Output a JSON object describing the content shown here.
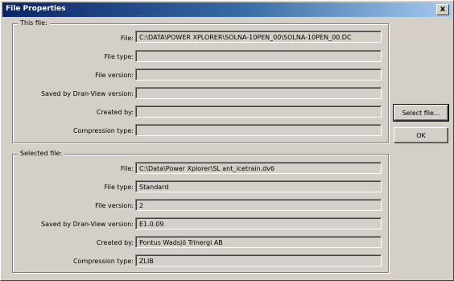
{
  "window": {
    "title": "File Properties",
    "close_label": "x"
  },
  "this_file": {
    "legend": "This file:",
    "rows": [
      {
        "label": "File:",
        "value": "C:\\DATA\\POWER XPLORER\\SOLNA-10PEN_00\\SOLNA-10PEN_00.DC"
      },
      {
        "label": "File type:",
        "value": ""
      },
      {
        "label": "File version:",
        "value": ""
      },
      {
        "label": "Saved by Dran-View version:",
        "value": ""
      },
      {
        "label": "Created by:",
        "value": ""
      },
      {
        "label": "Compression type:",
        "value": ""
      }
    ]
  },
  "selected_file": {
    "legend": "Selected file:",
    "rows": [
      {
        "label": "File:",
        "value": "C:\\Data\\Power Xplorer\\SL ant_icetrain.dv6"
      },
      {
        "label": "File type:",
        "value": "Standard"
      },
      {
        "label": "File version:",
        "value": "2"
      },
      {
        "label": "Saved by Dran-View version:",
        "value": "E1.0.09"
      },
      {
        "label": "Created by:",
        "value": "Pontus Wadsjö Trinergi AB"
      },
      {
        "label": "Compression type:",
        "value": "ZLIB"
      }
    ]
  },
  "buttons": {
    "select_file": "Select file...",
    "ok": "OK"
  }
}
